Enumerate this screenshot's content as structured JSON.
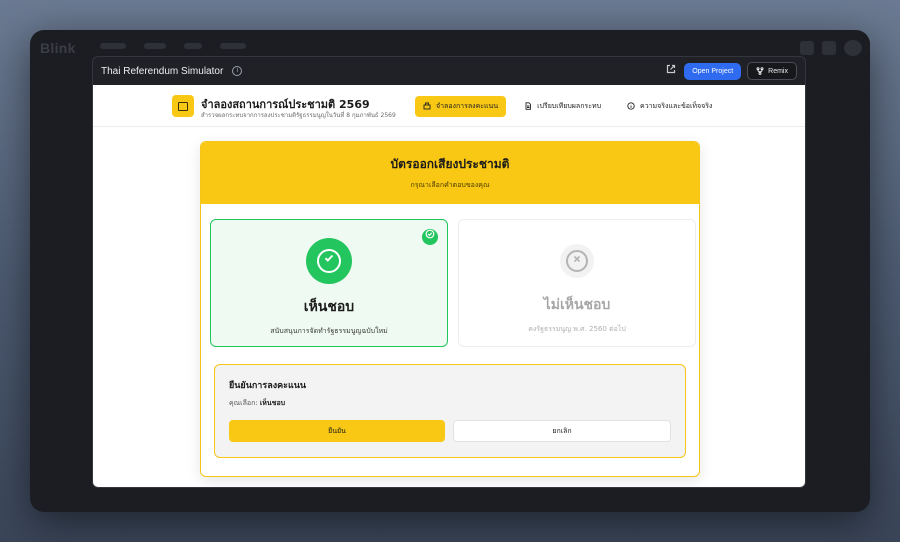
{
  "platform": {
    "brand": "Blink"
  },
  "window": {
    "title": "Thai Referendum Simulator",
    "open_project_label": "Open Project",
    "remix_label": "Remix"
  },
  "app": {
    "title": "จำลองสถานการณ์ประชามติ 2569",
    "subtitle": "สำรวจผลกระทบจากการลงประชามติรัฐธรรมนูญในวันที่ 8 กุมภาพันธ์ 2569",
    "nav": [
      {
        "label": "จำลองการลงคะแนน",
        "icon": "ballot-box-icon",
        "active": true
      },
      {
        "label": "เปรียบเทียบผลกระทบ",
        "icon": "document-icon",
        "active": false
      },
      {
        "label": "ความจริงและข้อเท็จจริง",
        "icon": "info-icon",
        "active": false
      }
    ]
  },
  "ballot": {
    "title": "บัตรออกเสียงประชามติ",
    "subtitle": "กรุณาเลือกคำตอบของคุณ",
    "options": {
      "yes": {
        "label": "เห็นชอบ",
        "description": "สนับสนุนการจัดทำรัฐธรรมนูญฉบับใหม่",
        "selected": true
      },
      "no": {
        "label": "ไม่เห็นชอบ",
        "description": "คงรัฐธรรมนูญ พ.ศ. 2560 ต่อไป",
        "selected": false
      }
    }
  },
  "confirm": {
    "title": "ยืนยันการลงคะแนน",
    "choice_prefix": "คุณเลือก:",
    "choice_value": "เห็นชอบ",
    "confirm_label": "ยืนยัน",
    "cancel_label": "ยกเลิก"
  },
  "colors": {
    "accent_yellow": "#f9c814",
    "success_green": "#22c55e",
    "primary_blue": "#2f6bf0"
  }
}
